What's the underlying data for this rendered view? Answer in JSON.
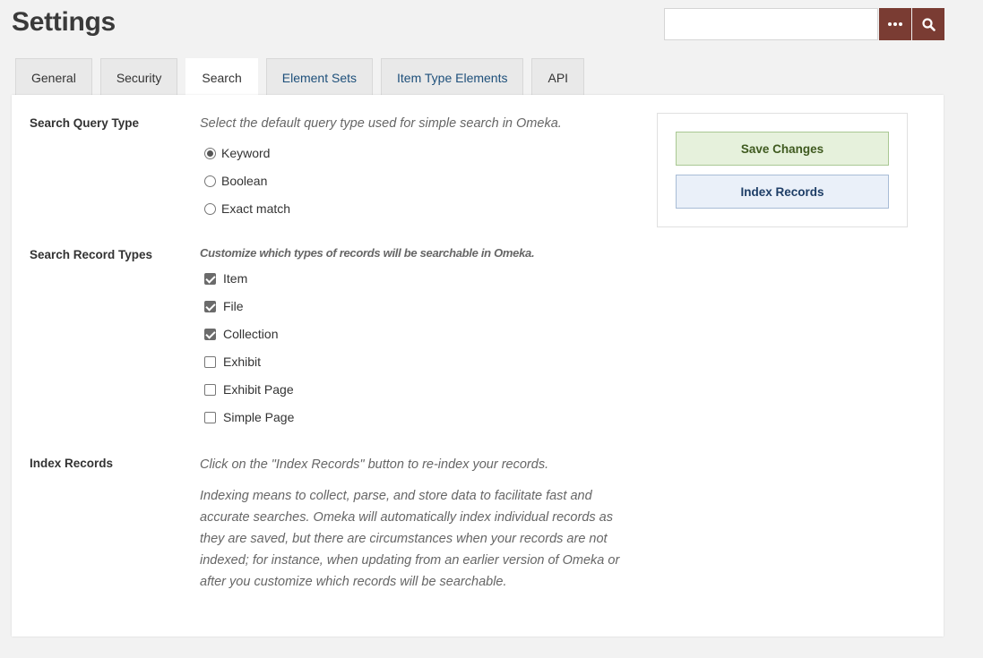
{
  "page": {
    "title": "Settings"
  },
  "search": {
    "placeholder": "",
    "more_icon": "ellipsis-icon",
    "search_icon": "search-icon"
  },
  "colors": {
    "accent": "#7a3c33",
    "save_bg": "#e6f1dc",
    "index_bg": "#eaf0f9",
    "link": "#1d4f7a"
  },
  "tabs": [
    {
      "label": "General",
      "active": false
    },
    {
      "label": "Security",
      "active": false
    },
    {
      "label": "Search",
      "active": true
    },
    {
      "label": "Element Sets",
      "active": false
    },
    {
      "label": "Item Type Elements",
      "active": false
    },
    {
      "label": "API",
      "active": false
    }
  ],
  "query_type": {
    "label": "Search Query Type",
    "description": "Select the default query type used for simple search in Omeka.",
    "options": [
      {
        "label": "Keyword",
        "checked": true
      },
      {
        "label": "Boolean",
        "checked": false
      },
      {
        "label": "Exact match",
        "checked": false
      }
    ]
  },
  "record_types": {
    "label": "Search Record Types",
    "description": "Customize which types of records will be searchable in Omeka.",
    "options": [
      {
        "label": "Item",
        "checked": true
      },
      {
        "label": "File",
        "checked": true
      },
      {
        "label": "Collection",
        "checked": true
      },
      {
        "label": "Exhibit",
        "checked": false
      },
      {
        "label": "Exhibit Page",
        "checked": false
      },
      {
        "label": "Simple Page",
        "checked": false
      }
    ]
  },
  "index": {
    "label": "Index Records",
    "description": "Click on the \"Index Records\" button to re-index your records.",
    "paragraph": "Indexing means to collect, parse, and store data to facilitate fast and accurate searches. Omeka will automatically index individual records as they are saved, but there are circumstances when your records are not indexed; for instance, when updating from an earlier version of Omeka or after you customize which records will be searchable."
  },
  "actions": {
    "save_label": "Save Changes",
    "index_label": "Index Records"
  }
}
